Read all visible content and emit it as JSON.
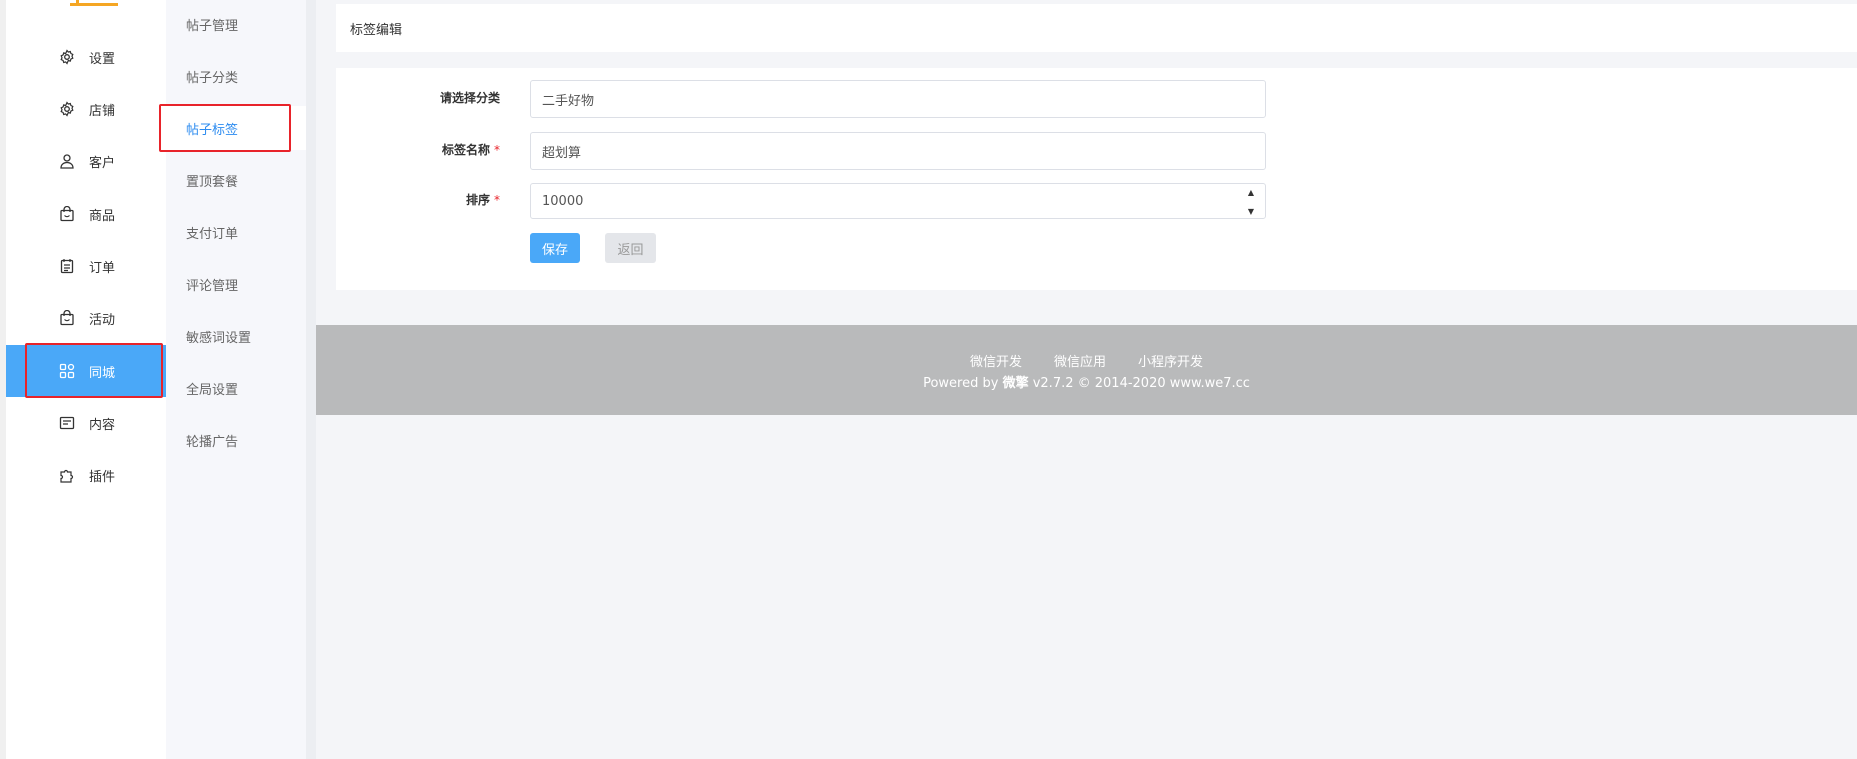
{
  "primary_nav": {
    "items": [
      {
        "label": "设置",
        "icon": "gear-icon"
      },
      {
        "label": "店铺",
        "icon": "store-icon"
      },
      {
        "label": "客户",
        "icon": "user-icon"
      },
      {
        "label": "商品",
        "icon": "bag-icon"
      },
      {
        "label": "订单",
        "icon": "order-icon"
      },
      {
        "label": "活动",
        "icon": "activity-icon"
      },
      {
        "label": "同城",
        "icon": "grid-icon"
      },
      {
        "label": "内容",
        "icon": "content-icon"
      },
      {
        "label": "插件",
        "icon": "plugin-icon"
      }
    ],
    "active_index": 6
  },
  "secondary_nav": {
    "items": [
      {
        "label": "帖子管理"
      },
      {
        "label": "帖子分类"
      },
      {
        "label": "帖子标签"
      },
      {
        "label": "置顶套餐"
      },
      {
        "label": "支付订单"
      },
      {
        "label": "评论管理"
      },
      {
        "label": "敏感词设置"
      },
      {
        "label": "全局设置"
      },
      {
        "label": "轮播广告"
      }
    ],
    "active_index": 2
  },
  "page": {
    "title": "标签编辑"
  },
  "form": {
    "category": {
      "label": "请选择分类",
      "value": "二手好物"
    },
    "tag_name": {
      "label": "标签名称",
      "required_mark": "*",
      "value": "超划算"
    },
    "sort": {
      "label": "排序",
      "required_mark": "*",
      "value": "10000"
    },
    "save_label": "保存",
    "back_label": "返回"
  },
  "footer": {
    "links": [
      "微信开发",
      "微信应用",
      "小程序开发"
    ],
    "copyright_prefix": "Powered by",
    "brand": "微擎",
    "copyright_suffix": "v2.7.2 © 2014-2020 www.we7.cc"
  },
  "colors": {
    "accent": "#4aa8f8",
    "active_link": "#2d8cf0",
    "highlight_box": "#e8232a",
    "footer_bg": "#b9babb"
  }
}
